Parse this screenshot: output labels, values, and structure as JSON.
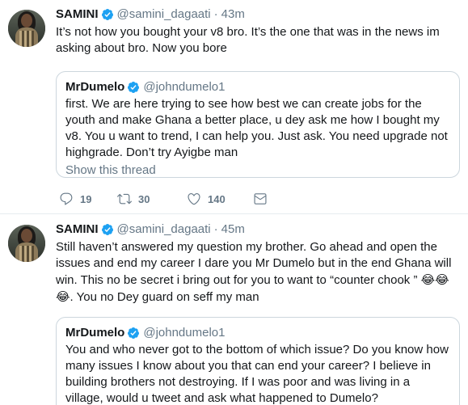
{
  "tweets": [
    {
      "author": {
        "name": "SAMINI",
        "handle": "@samini_dagaati"
      },
      "separator": "·",
      "time": "43m",
      "text": "It’s not how you bought your v8 bro. It’s the one that was in the news im asking about bro. Now you bore",
      "quote": {
        "name": "MrDumelo",
        "handle": "@johndumelo1",
        "text": "first. We are here trying to see how best we can create jobs for the youth and make Ghana a better place, u dey ask me how I bought my v8. You u want to trend, I can help you. Just ask. You need upgrade not highgrade. Don’t try Ayigbe man",
        "show_thread": "Show this thread"
      },
      "stats": {
        "replies": "19",
        "retweets": "30",
        "likes": "140"
      }
    },
    {
      "author": {
        "name": "SAMINI",
        "handle": "@samini_dagaati"
      },
      "separator": "·",
      "time": "45m",
      "text_before": "Still haven’t answered my question my brother. Go ahead and open the issues and end my career I dare you Mr Dumelo but in the end Ghana will win. This no be secret i bring out for you to want to “counter chook ” ",
      "emoji": "😂😂😂",
      "text_after": ". You no Dey guard on seff my man",
      "quote": {
        "name": "MrDumelo",
        "handle": "@johndumelo1",
        "text": "You and who never got to the bottom of which issue? Do you know how many issues I know about you that can end your career? I believe in building brothers not destroying. If I was poor and was living in a village, would u tweet and ask what happened to Dumelo? twitter.com/samini_dagaati..."
      }
    }
  ],
  "colors": {
    "verified": "#1da1f2",
    "muted": "#657786",
    "text": "#14171a",
    "border": "#ccd6dd"
  },
  "icons": [
    "verified-badge-icon",
    "reply-icon",
    "retweet-icon",
    "like-icon",
    "message-icon"
  ]
}
